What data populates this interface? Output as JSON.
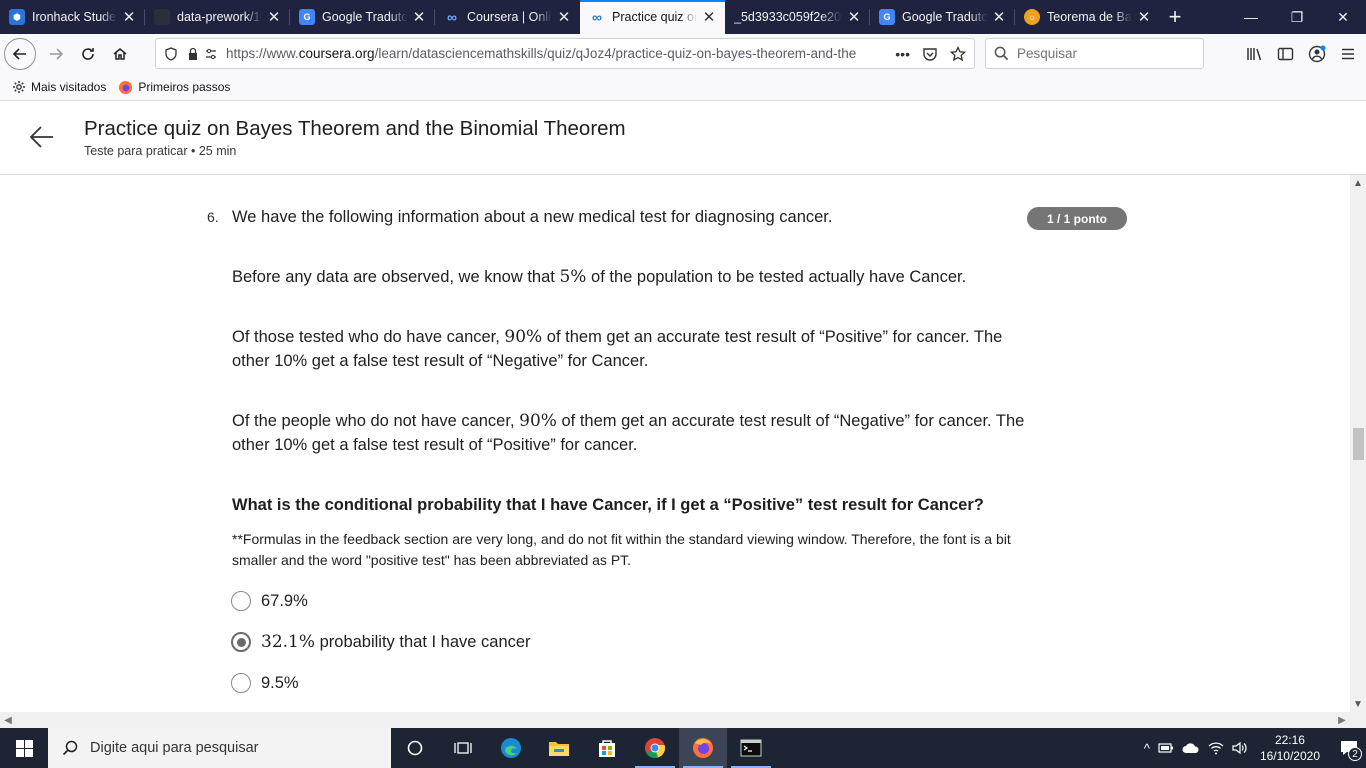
{
  "browser": {
    "tabs": [
      {
        "title": "Ironhack Student",
        "favicon_color": "#2b75d6",
        "active": false
      },
      {
        "title": "data-prework/1",
        "favicon_color": "#24292e",
        "active": false
      },
      {
        "title": "Google Tradutor",
        "favicon_color": "#4285f4",
        "active": false
      },
      {
        "title": "Coursera | Online",
        "favicon_color": "#2a73cc",
        "active": false
      },
      {
        "title": "Practice quiz on",
        "favicon_color": "#2a73cc",
        "active": true
      },
      {
        "title": "_5d3933c059f2e209",
        "favicon_color": "#202340",
        "active": false
      },
      {
        "title": "Google Tradutor",
        "favicon_color": "#4285f4",
        "active": false
      },
      {
        "title": "Teorema de Bay",
        "favicon_color": "#f0a020",
        "active": false
      }
    ],
    "url_prefix": "https://www.",
    "url_host": "coursera.org",
    "url_path": "/learn/datasciencemathskills/quiz/qJoz4/practice-quiz-on-bayes-theorem-and-the",
    "search_placeholder": "Pesquisar",
    "bookmarks": [
      "Mais visitados",
      "Primeiros passos"
    ]
  },
  "header": {
    "title": "Practice quiz on Bayes Theorem and the Binomial Theorem",
    "subtitle": "Teste para praticar • 25 min"
  },
  "question": {
    "number": "6.",
    "points": "1 / 1 ponto",
    "intro": "We have the following information about a new medical test for diagnosing cancer.",
    "p1_a": "Before any data are observed, we know that ",
    "p1_num": "5%",
    "p1_b": " of the population to be tested actually have Cancer.",
    "p2_a": "Of those tested who do have cancer, ",
    "p2_num": "90%",
    "p2_b": " of them get an accurate test result of “Positive” for cancer. The other 10% get a false test result of “Negative” for Cancer.",
    "p3_a": "Of the people who do not have cancer, ",
    "p3_num": "90%",
    "p3_b": " of them get an accurate test result of “Negative” for cancer. The other 10% get a false test result of “Positive” for cancer.",
    "prompt": "What is the conditional probability that I have Cancer, if I get a “Positive” test result for Cancer?",
    "note": "**Formulas in the feedback section are very long, and do not fit within the standard viewing window. Therefore, the font is a bit smaller and the word \"positive test\" has been abbreviated as PT.",
    "options": [
      {
        "num": "",
        "label": "67.9%",
        "selected": false
      },
      {
        "num": "32.1%",
        "label": " probability that I have cancer",
        "selected": true
      },
      {
        "num": "",
        "label": "9.5%",
        "selected": false
      }
    ]
  },
  "taskbar": {
    "search_placeholder": "Digite aqui para pesquisar",
    "time": "22:16",
    "date": "16/10/2020",
    "notification_count": "2"
  }
}
